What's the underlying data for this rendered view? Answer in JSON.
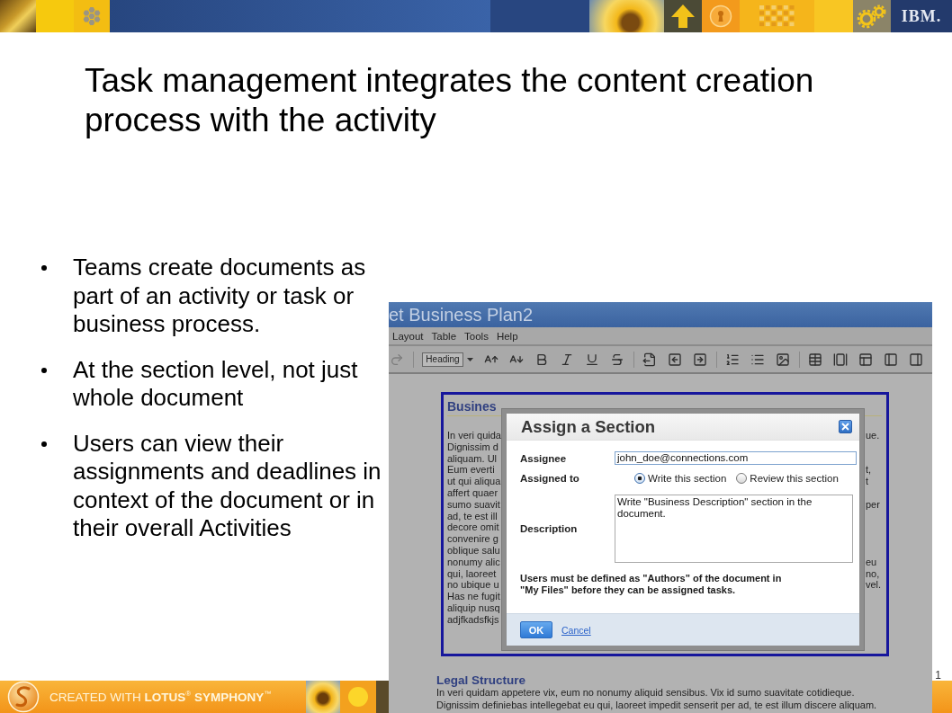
{
  "banner": {
    "logo": "IBM."
  },
  "slide": {
    "title": "Task management integrates the content creation process with the activity",
    "bullets": [
      "Teams create documents as part of an activity or task or business process.",
      "At the section level, not just whole document",
      "Users can view their assignments and deadlines in context of the document or in their overall Activities"
    ]
  },
  "screenshot": {
    "window_title": "et Business Plan2",
    "menu": [
      "Layout",
      "Table",
      "Tools",
      "Help"
    ],
    "toolbar": {
      "redo": {
        "disabled": true
      },
      "style": "Heading"
    },
    "document": {
      "section": {
        "heading": "Busines",
        "lines": [
          {
            "left": "In veri quida",
            "right": "ue."
          },
          {
            "left": "Dignissim d"
          },
          {
            "left": "aliquam. Ul"
          },
          {
            "left": "Eum everti",
            "right": "t,"
          },
          {
            "left": "ut qui aliqua",
            "right": "t"
          },
          {
            "left": "affert quaer"
          },
          {
            "left": "sumo suavit",
            "right": "per"
          },
          {
            "left": "ad, te est ill"
          },
          {
            "left": "decore omit"
          },
          {
            "left": "convenire g"
          },
          {
            "left": "oblique salu"
          },
          {
            "left": "nonumy alic",
            "right": "eu"
          },
          {
            "left": "qui, laoreet",
            "right": "no,"
          },
          {
            "left": "no ubique u",
            "right": "vel."
          },
          {
            "left": "Has ne fugit"
          },
          {
            "left": "aliquip nusq"
          },
          {
            "left": "adjfkadsfkjs"
          }
        ]
      },
      "next_section": {
        "heading": "Legal Structure",
        "lines": [
          "In veri quidam appetere vix, eum no nonumy aliquid sensibus. Vix id sumo suavitate cotidieque.",
          "Dignissim definiebas intellegebat eu qui, laoreet impedit senserit per ad, te est illum discere aliquam."
        ]
      }
    },
    "dialog": {
      "title": "Assign a Section",
      "assignee": {
        "label": "Assignee",
        "value": "john_doe@connections.com"
      },
      "assigned_to": {
        "label": "Assigned to",
        "options": [
          {
            "label": "Write this section",
            "selected": true
          },
          {
            "label": "Review this section",
            "selected": false
          }
        ]
      },
      "description": {
        "label": "Description",
        "value": "Write \"Business Description\" section in the document."
      },
      "note": "Users must be defined as \"Authors\" of the document in \"My Files\" before they can be assigned tasks.",
      "ok": "OK",
      "cancel": "Cancel"
    }
  },
  "footer": {
    "credit": "CREATED WITH **LOTUS**$^{®}$ **SYMPHONY**$^{™}$",
    "page_number": "1"
  }
}
